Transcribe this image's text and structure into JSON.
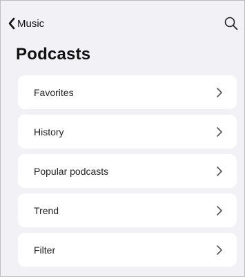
{
  "header": {
    "back_label": "Music",
    "back_icon": "chevron-left-icon",
    "search_icon": "search-icon"
  },
  "page": {
    "title": "Podcasts"
  },
  "list": {
    "items": [
      {
        "label": "Favorites"
      },
      {
        "label": "History"
      },
      {
        "label": "Popular podcasts"
      },
      {
        "label": "Trend"
      },
      {
        "label": "Filter"
      }
    ],
    "chevron_icon": "chevron-right-icon"
  },
  "colors": {
    "background": "#f2f2f6",
    "card": "#ffffff",
    "text": "#111111",
    "chevron": "#555555"
  }
}
